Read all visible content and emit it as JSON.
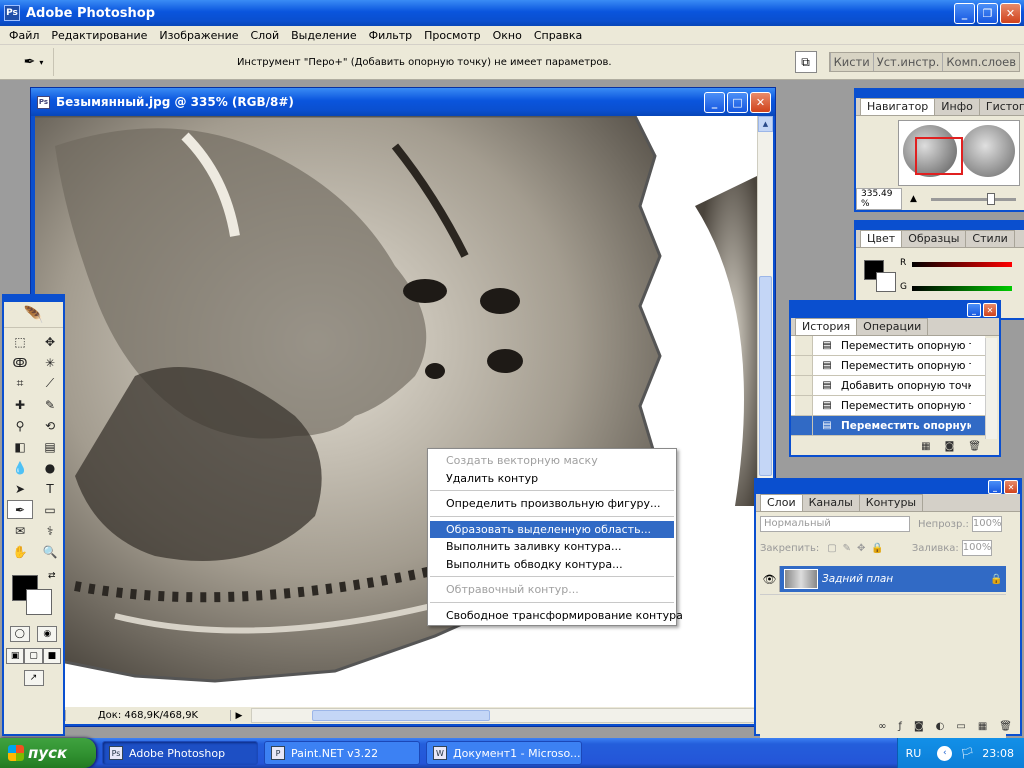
{
  "app": {
    "title": "Adobe Photoshop",
    "logo_text": "Ps"
  },
  "menu": [
    "Файл",
    "Редактирование",
    "Изображение",
    "Слой",
    "Выделение",
    "Фильтр",
    "Просмотр",
    "Окно",
    "Справка"
  ],
  "options_bar": {
    "message": "Инструмент \"Перо+\" (Добавить опорную точку) не имеет параметров.",
    "well_tabs": [
      "Кисти",
      "Уст.инстр.",
      "Комп.слоев"
    ]
  },
  "document": {
    "title": "Безымянный.jpg @ 335% (RGB/8#)",
    "zoom_fragment": "9",
    "size": "Док: 468,9K/468,9K"
  },
  "context_menu": {
    "items": [
      {
        "label": "Создать векторную маску",
        "disabled": true
      },
      {
        "label": "Удалить контур",
        "disabled": false
      },
      {
        "sep": true
      },
      {
        "label": "Определить произвольную фигуру...",
        "disabled": false
      },
      {
        "sep": true
      },
      {
        "label": "Образовать выделенную область...",
        "disabled": false,
        "highlighted": true
      },
      {
        "label": "Выполнить заливку контура...",
        "disabled": false
      },
      {
        "label": "Выполнить обводку контура...",
        "disabled": false
      },
      {
        "sep": true
      },
      {
        "label": "Обтравочный контур...",
        "disabled": true
      },
      {
        "sep": true
      },
      {
        "label": "Свободное трансформирование контура",
        "disabled": false
      }
    ]
  },
  "navigator": {
    "tabs": [
      "Навигатор",
      "Инфо",
      "Гистограмма"
    ],
    "zoom": "335.49 %"
  },
  "color_palette": {
    "tabs": [
      "Цвет",
      "Образцы",
      "Стили"
    ],
    "channels": [
      "R",
      "G"
    ]
  },
  "history": {
    "tabs": [
      "История",
      "Операции"
    ],
    "items": [
      {
        "label": "Переместить опорную т...",
        "current": false
      },
      {
        "label": "Переместить опорную т...",
        "current": false
      },
      {
        "label": "Добавить опорную точку",
        "current": false
      },
      {
        "label": "Переместить опорную т...",
        "current": false
      },
      {
        "label": "Переместить опорную...",
        "current": true
      }
    ]
  },
  "layers": {
    "tabs": [
      "Слои",
      "Каналы",
      "Контуры"
    ],
    "blend_mode": "Нормальный",
    "opacity_label": "Непрозр.:",
    "opacity": "100%",
    "lock_label": "Закрепить:",
    "fill_label": "Заливка:",
    "fill": "100%",
    "layer_name": "Задний план"
  },
  "taskbar": {
    "start_label": "пуск",
    "tasks": [
      {
        "label": "Adobe Photoshop",
        "active": true
      },
      {
        "label": "Paint.NET v3.22",
        "active": false
      },
      {
        "label": "Документ1 - Microso...",
        "active": false
      }
    ],
    "lang": "RU",
    "clock": "23:08"
  },
  "colors": {
    "xp_blue": "#0a4fcf",
    "highlight": "#316ac5",
    "chrome": "#ece9d8"
  }
}
